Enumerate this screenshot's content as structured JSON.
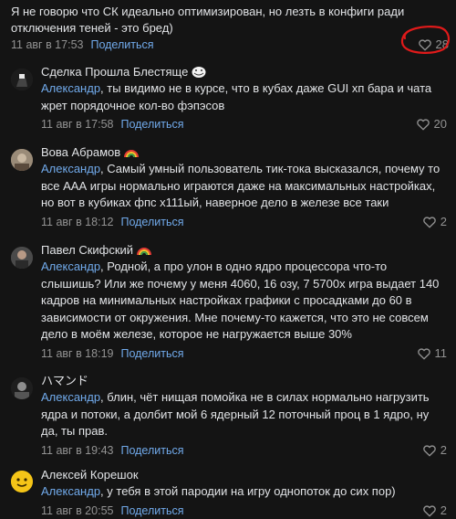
{
  "root": {
    "text": "Я не говорю что СК идеально оптимизирован, но лезть в конфиги ради отключения теней - это бред)",
    "date": "11 авг в 17:53",
    "share_label": "Поделиться",
    "likes": "28"
  },
  "replies": [
    {
      "author": "Сделка Прошла Блестяще",
      "emoji": "troll-face-icon",
      "mention": "Александр",
      "text": ", ты видимо не в курсе, что в кубах даже GUI хп бара и чата жрет порядочное кол-во фэпэсов",
      "date": "11 авг в 17:58",
      "share_label": "Поделиться",
      "likes": "20"
    },
    {
      "author": "Вова Абрамов",
      "emoji": "rainbow-icon",
      "mention": "Александр",
      "text": ", Самый умный пользователь тик-тока высказался, почему то все ААА игры нормально играются даже на максимальных настройках, но вот в кубиках фпс х111ый, наверное дело в железе все таки",
      "date": "11 авг в 18:12",
      "share_label": "Поделиться",
      "likes": "2"
    },
    {
      "author": "Павел Скифский",
      "emoji": "rainbow-icon",
      "mention": "Александр",
      "text": ", Родной, а про улон в одно ядро процессора что-то слышишь? Или же почему у меня 4060, 16 озу, 7 5700х игра выдает 140 кадров на минимальных настройках графики с просадками до 60 в зависимости от окружения. Мне почему-то кажется, что это не совсем дело в моём железе, которое не нагружается выше 30%",
      "date": "11 авг в 18:19",
      "share_label": "Поделиться",
      "likes": "11"
    },
    {
      "author": "ハマンド",
      "emoji": "",
      "mention": "Александр",
      "text": ", блин, чёт нищая помойка не в силах нормально нагрузить ядра и потоки, а долбит мой 6 ядерный 12 поточный проц в 1 ядро, ну да, ты прав.",
      "date": "11 авг в 19:43",
      "share_label": "Поделиться",
      "likes": "2"
    },
    {
      "author": "Алексей Корешок",
      "emoji": "",
      "mention": "Александр",
      "text": ", у тебя в этой пародии на игру однопоток до сих пор)",
      "date": "11 авг в 20:55",
      "share_label": "Поделиться",
      "likes": "2"
    }
  ],
  "colors": {
    "background": "#141414",
    "text": "#e1e3e6",
    "muted": "#939393",
    "link": "#71aaeb",
    "annotation": "#e01a1a"
  }
}
